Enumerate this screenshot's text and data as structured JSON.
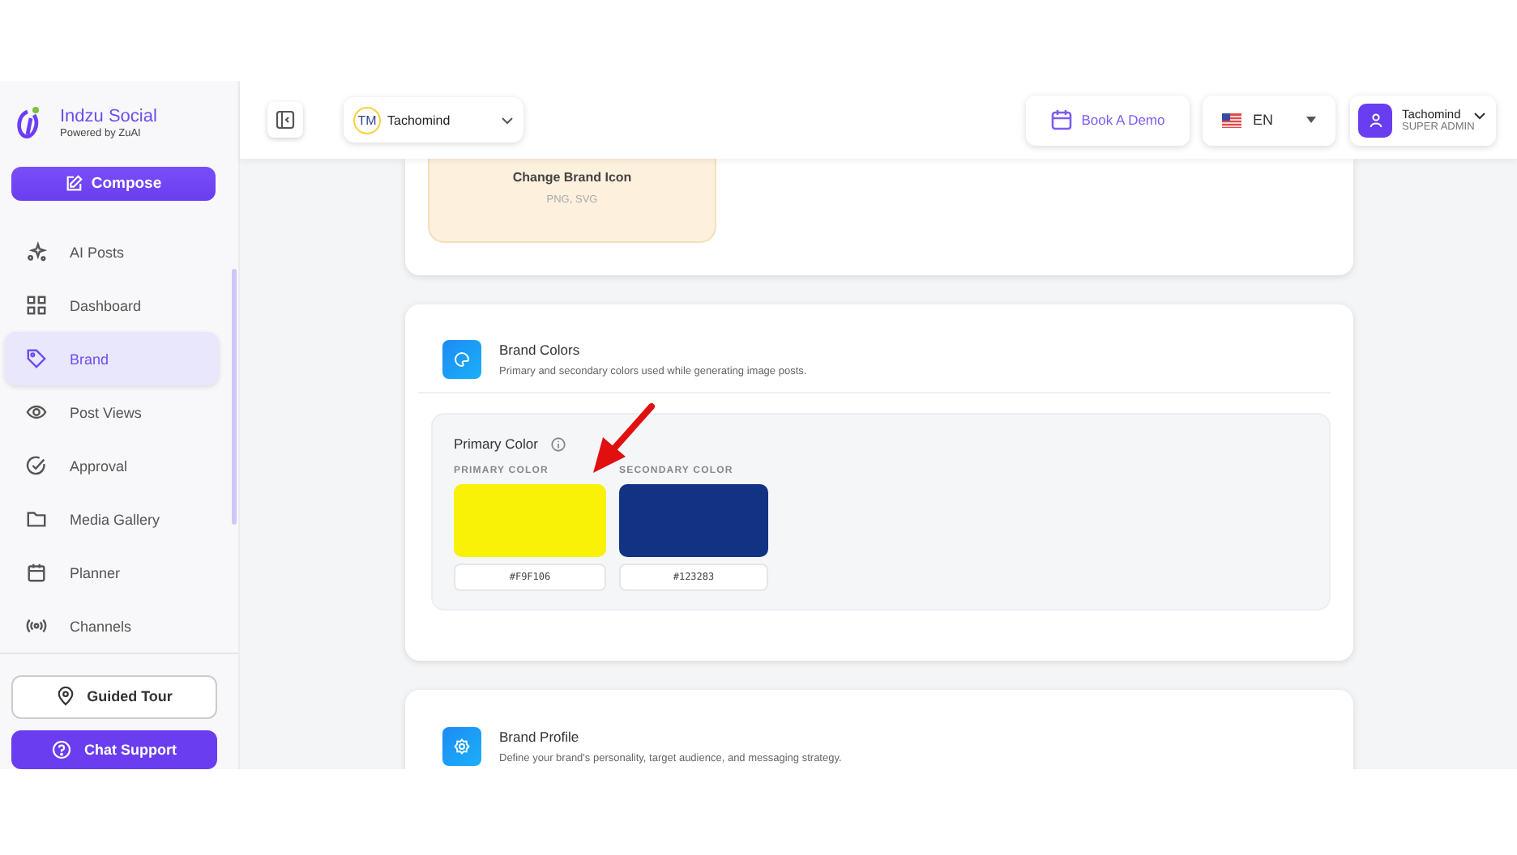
{
  "sidebar": {
    "app_name": "Indzu Social",
    "tagline": "Powered by ZuAI",
    "compose": "Compose",
    "items": [
      {
        "label": "AI Posts",
        "selected": false
      },
      {
        "label": "Dashboard",
        "selected": false
      },
      {
        "label": "Brand",
        "selected": true
      },
      {
        "label": "Post Views",
        "selected": false
      },
      {
        "label": "Approval",
        "selected": false
      },
      {
        "label": "Media Gallery",
        "selected": false
      },
      {
        "label": "Planner",
        "selected": false
      },
      {
        "label": "Channels",
        "selected": false
      }
    ],
    "guided_tour": "Guided Tour",
    "chat_support": "Chat Support"
  },
  "header": {
    "brand_initials": "TM",
    "brand_name": "Tachomind",
    "book_demo": "Book A Demo",
    "language": "EN",
    "user_name": "Tachomind",
    "user_role": "SUPER ADMIN"
  },
  "brand_icon": {
    "title": "Change Brand Icon",
    "formats": "PNG, SVG"
  },
  "brand_colors": {
    "title": "Brand Colors",
    "description": "Primary and secondary colors used while generating image posts.",
    "panel_title": "Primary Color",
    "swatches": [
      {
        "label": "PRIMARY COLOR",
        "color": "#f9f106",
        "value": "#F9F106"
      },
      {
        "label": "SECONDARY COLOR",
        "color": "#123283",
        "value": "#123283"
      }
    ]
  },
  "brand_profile": {
    "title": "Brand Profile",
    "description": "Define your brand's personality, target audience, and messaging strategy."
  }
}
